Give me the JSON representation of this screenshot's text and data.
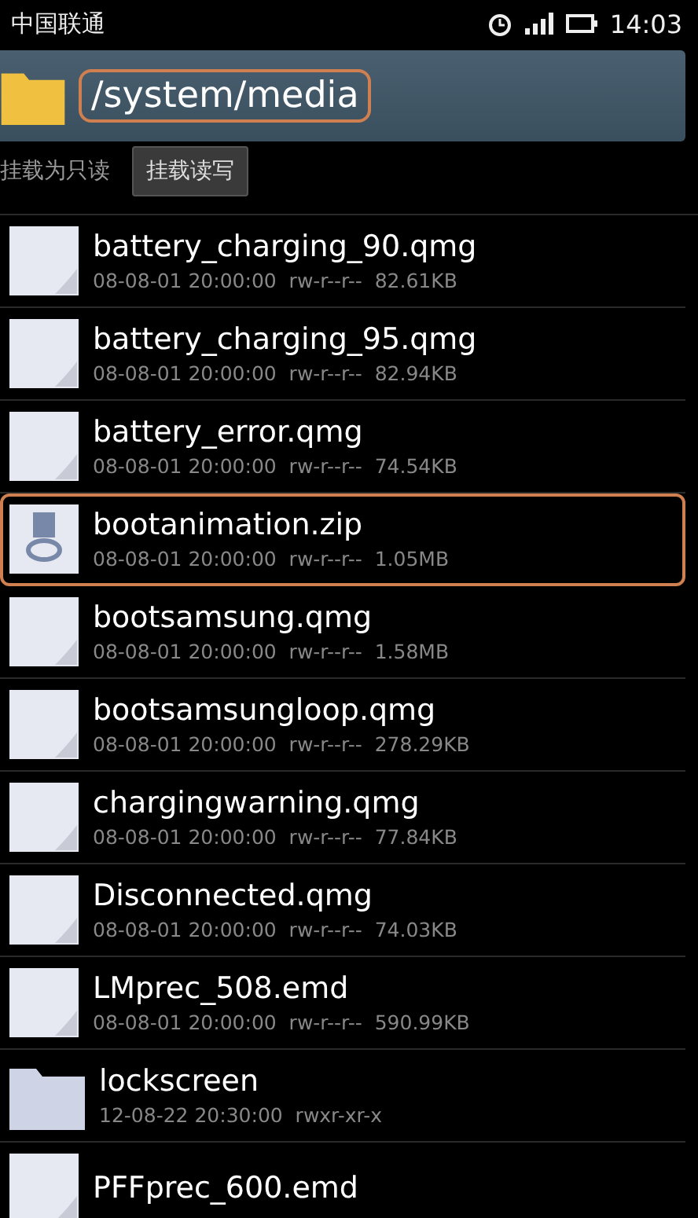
{
  "status_bar": {
    "carrier": "中国联通",
    "time": "14:03"
  },
  "path_bar": {
    "path": "/system/media",
    "highlighted": true
  },
  "mount_bar": {
    "label": "挂载为只读",
    "button": "挂载读写"
  },
  "files": [
    {
      "kind": "file",
      "name": "battery_charging_90.qmg",
      "meta": "08-08-01 20:00:00  rw-r--r--  82.61KB",
      "highlighted": false
    },
    {
      "kind": "file",
      "name": "battery_charging_95.qmg",
      "meta": "08-08-01 20:00:00  rw-r--r--  82.94KB",
      "highlighted": false
    },
    {
      "kind": "file",
      "name": "battery_error.qmg",
      "meta": "08-08-01 20:00:00  rw-r--r--  74.54KB",
      "highlighted": false
    },
    {
      "kind": "zip",
      "name": "bootanimation.zip",
      "meta": "08-08-01 20:00:00  rw-r--r--  1.05MB",
      "highlighted": true
    },
    {
      "kind": "file",
      "name": "bootsamsung.qmg",
      "meta": "08-08-01 20:00:00  rw-r--r--  1.58MB",
      "highlighted": false
    },
    {
      "kind": "file",
      "name": "bootsamsungloop.qmg",
      "meta": "08-08-01 20:00:00  rw-r--r--  278.29KB",
      "highlighted": false
    },
    {
      "kind": "file",
      "name": "chargingwarning.qmg",
      "meta": "08-08-01 20:00:00  rw-r--r--  77.84KB",
      "highlighted": false
    },
    {
      "kind": "file",
      "name": "Disconnected.qmg",
      "meta": "08-08-01 20:00:00  rw-r--r--  74.03KB",
      "highlighted": false
    },
    {
      "kind": "file",
      "name": "LMprec_508.emd",
      "meta": "08-08-01 20:00:00  rw-r--r--  590.99KB",
      "highlighted": false
    },
    {
      "kind": "folder",
      "name": "lockscreen",
      "meta": "12-08-22 20:30:00  rwxr-xr-x",
      "highlighted": false
    },
    {
      "kind": "file",
      "name": "PFFprec_600.emd",
      "highlighted": false
    }
  ]
}
